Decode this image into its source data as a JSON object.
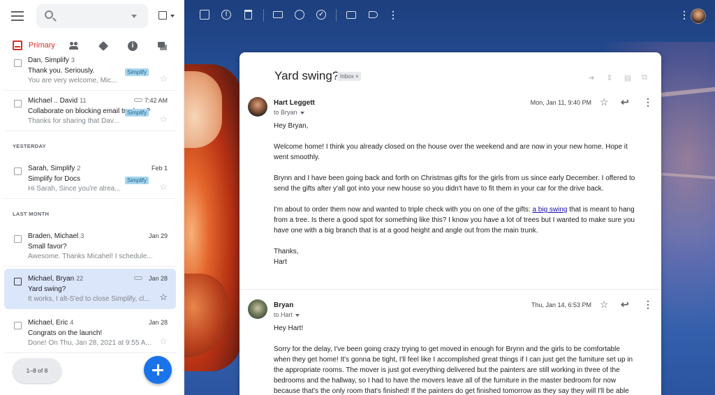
{
  "tabs": {
    "primary": "Primary",
    "icons": [
      "people-icon",
      "tag-icon",
      "info-icon",
      "forum-icon"
    ]
  },
  "search": {
    "placeholder": ""
  },
  "sections": {
    "yesterday": "YESTERDAY",
    "last_month": "LAST MONTH"
  },
  "emails": [
    {
      "from": "Dan, Simplify",
      "count": "3",
      "subject": "Thank you. Seriously.",
      "snippet": "You are very welcome, Mic...",
      "badge": "Simplify",
      "date": ""
    },
    {
      "from": "Michael .. David",
      "count": "11",
      "subject": "Collaborate on blocking email trackers?",
      "snippet": "Thanks for sharing that Dav...",
      "badge": "Simplify",
      "date": "7:42 AM",
      "attachment": true
    },
    {
      "from": "Sarah, Simplify",
      "count": "2",
      "subject": "Simplify for Docs",
      "snippet": "Hi Sarah, Since you're alrea...",
      "badge": "Simplify",
      "date": "Feb 1"
    },
    {
      "from": "Braden, Michael",
      "count": "3",
      "subject": "Small favor?",
      "snippet": "Awesome. Thanks Micahel! I schedule...",
      "badge": "",
      "date": "Jan 29"
    },
    {
      "from": "Michael, Bryan",
      "count": "22",
      "subject": "Yard swing?",
      "snippet": "It works, I alt-S'ed to close Simplify, cl...",
      "badge": "",
      "date": "Jan 28",
      "attachment": true,
      "selected": true
    },
    {
      "from": "Michael, Eric",
      "count": "4",
      "subject": "Congrats on the launch!",
      "snippet": "Done! On Thu, Jan 28, 2021 at 9:55 A...",
      "badge": "",
      "date": "Jan 28"
    }
  ],
  "pager": "1–8 of 8",
  "thread": {
    "subject": "Yard swing?",
    "label": "Inbox",
    "label_close": "×",
    "messages": [
      {
        "sender": "Hart Leggett",
        "to": "to Bryan",
        "date": "Mon, Jan 11, 9:40 PM",
        "greeting": "Hey Bryan,",
        "p1": "Welcome home! I think you already closed on the house over the weekend and are now in your new home. Hope it went smoothly.",
        "p2": "Brynn and I have been going back and forth on Christmas gifts for the girls from us since early December. I offered to send the gifts after y'all got into your new house so you didn't have to fit them in your car for the drive back.",
        "p3_pre": "I'm about to order them now and wanted to triple check with you on one of the gifts: ",
        "p3_link": "a big swing",
        "p3_post": " that is meant to hang from a tree. Is there a good spot for something like this? I know you have a lot of trees but I wanted to make sure you have one with a big branch that is at a good height and angle out from the main trunk.",
        "signoff": "Thanks,",
        "signature": "Hart"
      },
      {
        "sender": "Bryan",
        "to": "to Hart",
        "date": "Thu, Jan 14, 6:53 PM",
        "greeting": "Hey Hart!",
        "p1": "Sorry for the delay, I've been going crazy trying to get moved in enough for Brynn and the girls to be comfortable when they get home! It's gonna be tight, I'll feel like I accomplished great things if I can just get the furniture set up in the appropriate rooms. The mover is just got everything delivered but the painters are still working in three of the bedrooms and the hallway, so I had to have the movers leave all of the furniture in the master bedroom for now because that's the only room that's finished! If the painters do get finished tomorrow as they say they will I'll be able"
      }
    ]
  },
  "colors": {
    "accent": "#d93025",
    "selected_row": "#dce6fa",
    "badge": "#a8d6ee",
    "fab": "#1a73e8",
    "link": "#1a0dab"
  }
}
